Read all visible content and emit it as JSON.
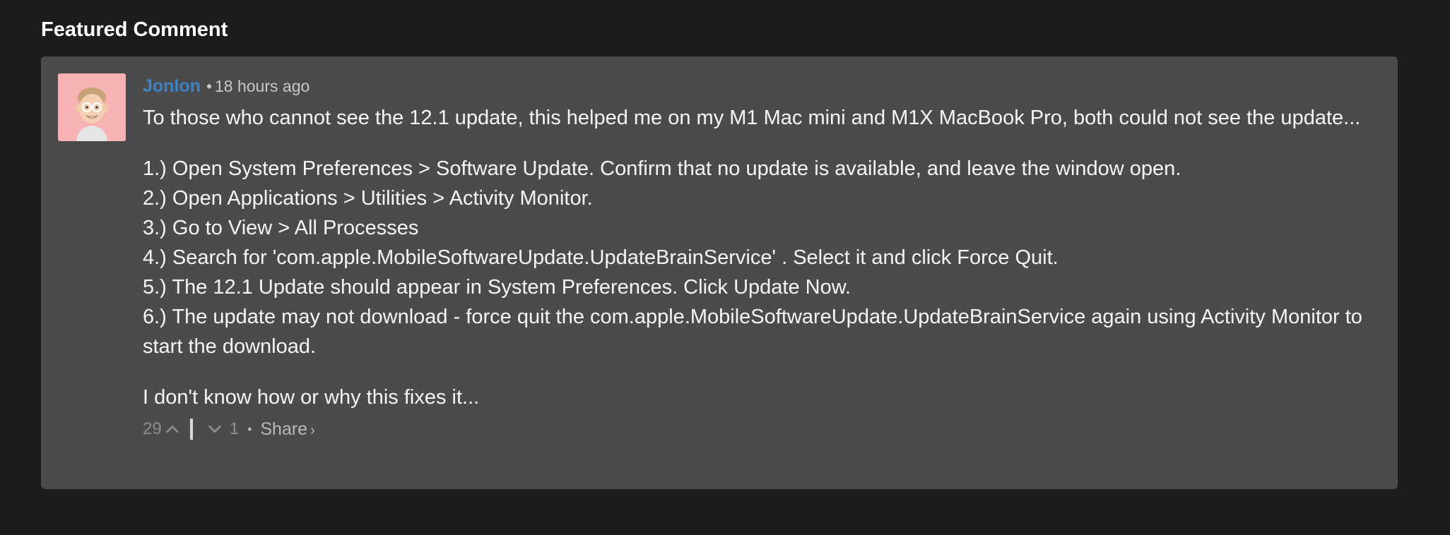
{
  "section": {
    "heading": "Featured Comment"
  },
  "comment": {
    "author": "JonIon",
    "separator": "•",
    "timestamp": "18 hours ago",
    "avatar_icon": "memoji-avatar-icon",
    "paragraphs": [
      "To those who cannot see the 12.1 update, this helped me on my M1 Mac mini and M1X MacBook Pro, both could not see the update...",
      "I don't know how or why this fixes it..."
    ],
    "steps": [
      "1.) Open System Preferences > Software Update. Confirm that no update is available, and leave the window open.",
      "2.) Open Applications > Utilities > Activity Monitor.",
      "3.) Go to View > All Processes",
      "4.) Search for 'com.apple.MobileSoftwareUpdate.UpdateBrainService' . Select it and click Force Quit.",
      "5.) The 12.1 Update should appear in System Preferences. Click Update Now.",
      "6.) The update may not download - force quit the com.apple.MobileSoftwareUpdate.UpdateBrainService again using Activity Monitor to start the download."
    ],
    "actions": {
      "upvotes": "29",
      "upvote_icon": "chevron-up-icon",
      "downvote_icon": "chevron-down-icon",
      "downvotes": "1",
      "dot": "•",
      "share_label": "Share",
      "share_arrow": "›"
    }
  },
  "colors": {
    "page_background": "#1c1c1e",
    "card_background": "#4b4b4d",
    "author_link": "#3c82c4",
    "avatar_background": "#f7b3b3"
  }
}
